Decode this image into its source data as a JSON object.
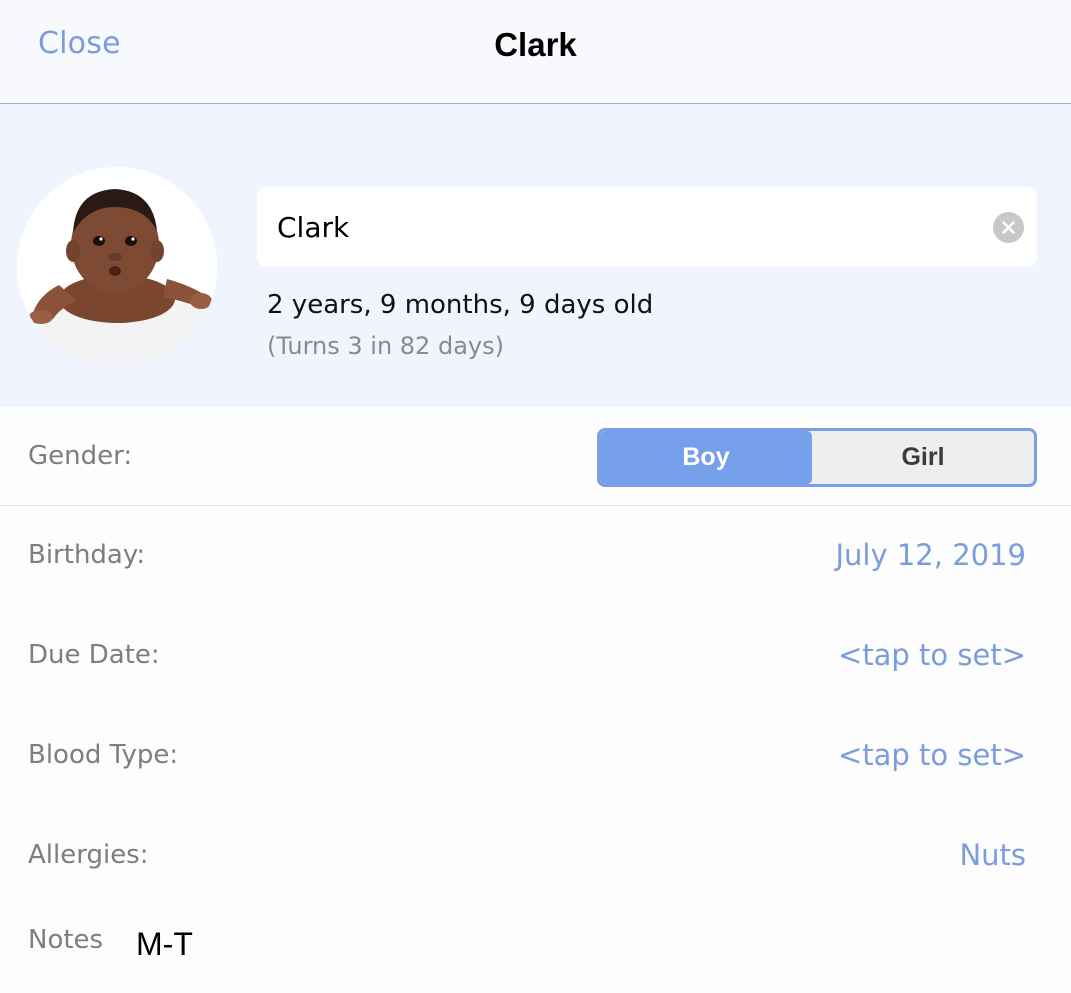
{
  "navbar": {
    "close_label": "Close",
    "title": "Clark"
  },
  "profile": {
    "name_value": "Clark",
    "age_text": "2 years, 9 months, 9 days old",
    "turns_text": "(Turns 3 in 82 days)",
    "avatar_icon": "baby-photo",
    "clear_icon": "clear-x-icon"
  },
  "gender": {
    "label": "Gender:",
    "options": [
      "Boy",
      "Girl"
    ],
    "selected": "Boy"
  },
  "details": [
    {
      "label": "Birthday:",
      "value": "July 12, 2019"
    },
    {
      "label": "Due Date:",
      "value": "<tap to set>"
    },
    {
      "label": "Blood Type:",
      "value": "<tap to set>"
    },
    {
      "label": "Allergies:",
      "value": "Nuts"
    }
  ],
  "notes": {
    "label": "Notes",
    "value": "M-T"
  },
  "colors": {
    "accent": "#7a9ddb",
    "segment_selected": "#77a0ea",
    "header_background": "#f0f4fe",
    "label_gray": "#7d7d82"
  }
}
